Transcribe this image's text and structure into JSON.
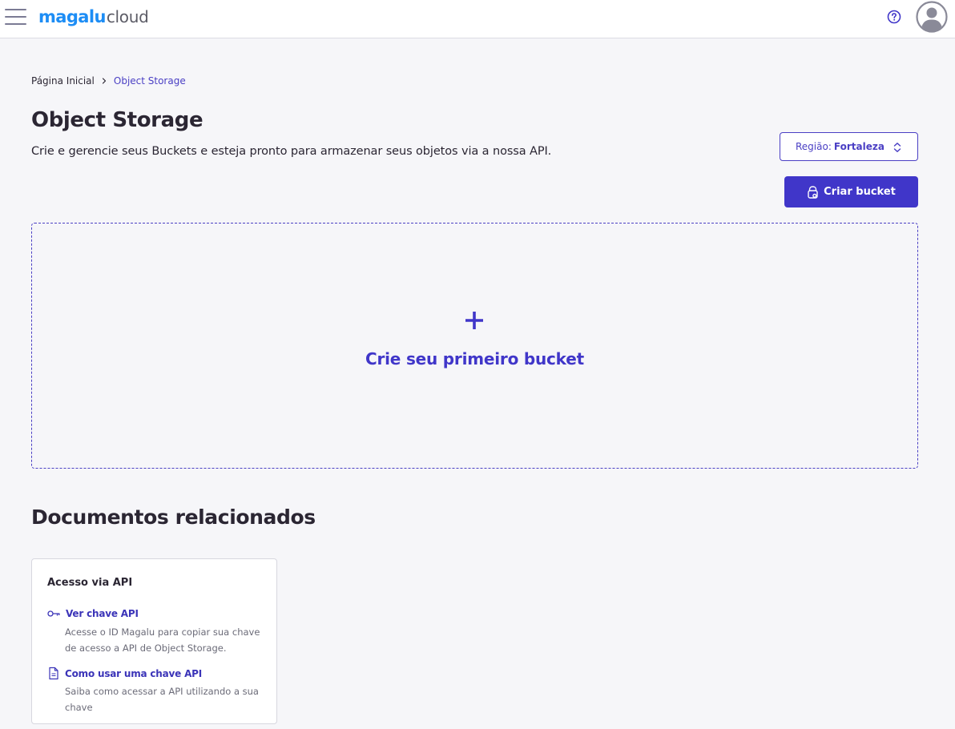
{
  "header": {
    "logo_brand": "magalu",
    "logo_product": "cloud",
    "menu_icon": "hamburger-menu-icon",
    "help_icon": "help-circle-icon",
    "avatar_icon": "user-avatar-icon"
  },
  "breadcrumb": {
    "home": "Página Inicial",
    "current": "Object Storage"
  },
  "page": {
    "title": "Object Storage",
    "subtitle": "Crie e gerencie seus Buckets e esteja pronto para armazenar seus objetos via a nossa API."
  },
  "region": {
    "label": "Região:",
    "value": "Fortaleza"
  },
  "actions": {
    "create_bucket": "Criar bucket"
  },
  "empty_state": {
    "text": "Crie seu primeiro bucket"
  },
  "docs": {
    "title": "Documentos relacionados",
    "card": {
      "title": "Acesso via API",
      "links": [
        {
          "label": "Ver chave API",
          "icon": "key-icon",
          "description": "Acesse o ID Magalu para copiar sua chave de acesso a API de Object Storage."
        },
        {
          "label": "Como usar uma chave API",
          "icon": "document-icon",
          "description": "Saiba como acessar a API utilizando a sua chave"
        }
      ]
    }
  },
  "colors": {
    "accent": "#4036c9",
    "logo_blue": "#1d8df5",
    "background": "#f6f6f9"
  }
}
